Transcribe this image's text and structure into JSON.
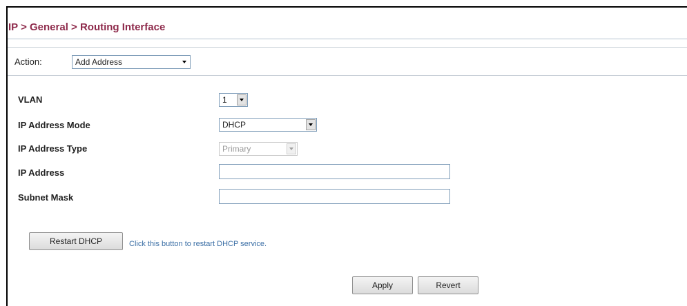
{
  "breadcrumb": {
    "text": "IP > General > Routing Interface"
  },
  "action": {
    "label": "Action:",
    "selected": "Add Address"
  },
  "fields": {
    "vlan": {
      "label": "VLAN",
      "value": "1"
    },
    "ip_mode": {
      "label": "IP Address Mode",
      "value": "DHCP"
    },
    "ip_type": {
      "label": "IP Address Type",
      "value": "Primary"
    },
    "ip_address": {
      "label": "IP Address",
      "value": ""
    },
    "subnet_mask": {
      "label": "Subnet Mask",
      "value": ""
    }
  },
  "restart": {
    "button_label": "Restart DHCP",
    "hint": "Click this button to restart DHCP service."
  },
  "footer": {
    "apply_label": "Apply",
    "revert_label": "Revert"
  },
  "colors": {
    "title": "#8e2a4b",
    "hint_link": "#3a6ea5",
    "input_border": "#7f9db9"
  }
}
